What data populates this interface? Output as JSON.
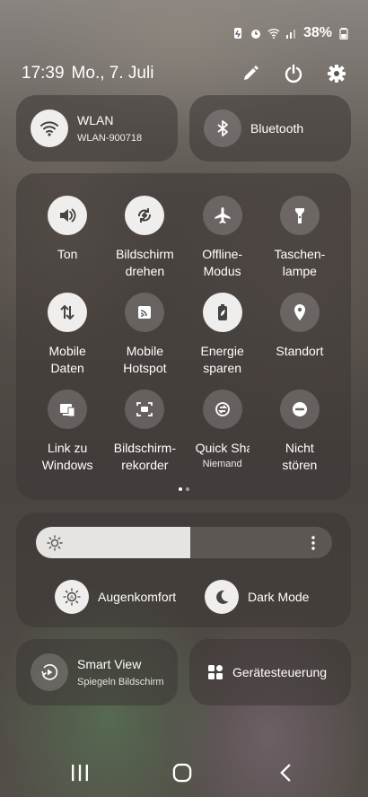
{
  "status": {
    "battery": "38%"
  },
  "header": {
    "time": "17:39",
    "date": "Mo., 7. Juli"
  },
  "wlan": {
    "label": "WLAN",
    "network": "WLAN-900718",
    "active": true
  },
  "bluetooth": {
    "label": "Bluetooth",
    "active": false
  },
  "tiles": [
    {
      "label": "Ton",
      "icon": "volume-icon",
      "active": true
    },
    {
      "label": "Bildschirm\ndrehen",
      "icon": "rotate-icon",
      "active": true
    },
    {
      "label": "Offline-\nModus",
      "icon": "airplane-icon",
      "active": false
    },
    {
      "label": "Taschen-\nlampe",
      "icon": "flashlight-icon",
      "active": false
    },
    {
      "label": "Mobile\nDaten",
      "icon": "mobile-data-icon",
      "active": true
    },
    {
      "label": "Mobile\nHotspot",
      "icon": "hotspot-icon",
      "active": false
    },
    {
      "label": "Energie\nsparen",
      "icon": "battery-leaf-icon",
      "active": true
    },
    {
      "label": "Standort",
      "icon": "location-icon",
      "active": false
    },
    {
      "label": "Link zu\nWindows",
      "icon": "link-windows-icon",
      "active": false
    },
    {
      "label": "Bildschirm-\nrekorder",
      "icon": "screen-recorder-icon",
      "active": false
    },
    {
      "label": "Quick Share",
      "sub": "Niemand",
      "icon": "quick-share-icon",
      "active": false
    },
    {
      "label": "Nicht\nstören",
      "icon": "do-not-disturb-icon",
      "active": false
    }
  ],
  "brightness": {
    "level_percent": 52
  },
  "eye_comfort": {
    "label": "Augenkomfort"
  },
  "dark_mode": {
    "label": "Dark Mode"
  },
  "smart_view": {
    "label": "Smart View",
    "sub": "Spiegeln     Bildschirm"
  },
  "device_control": {
    "label": "Gerätesteuerung"
  },
  "colors": {
    "accent_on": "#f0eeec",
    "card_bg": "rgba(60,55,52,0.55)"
  }
}
